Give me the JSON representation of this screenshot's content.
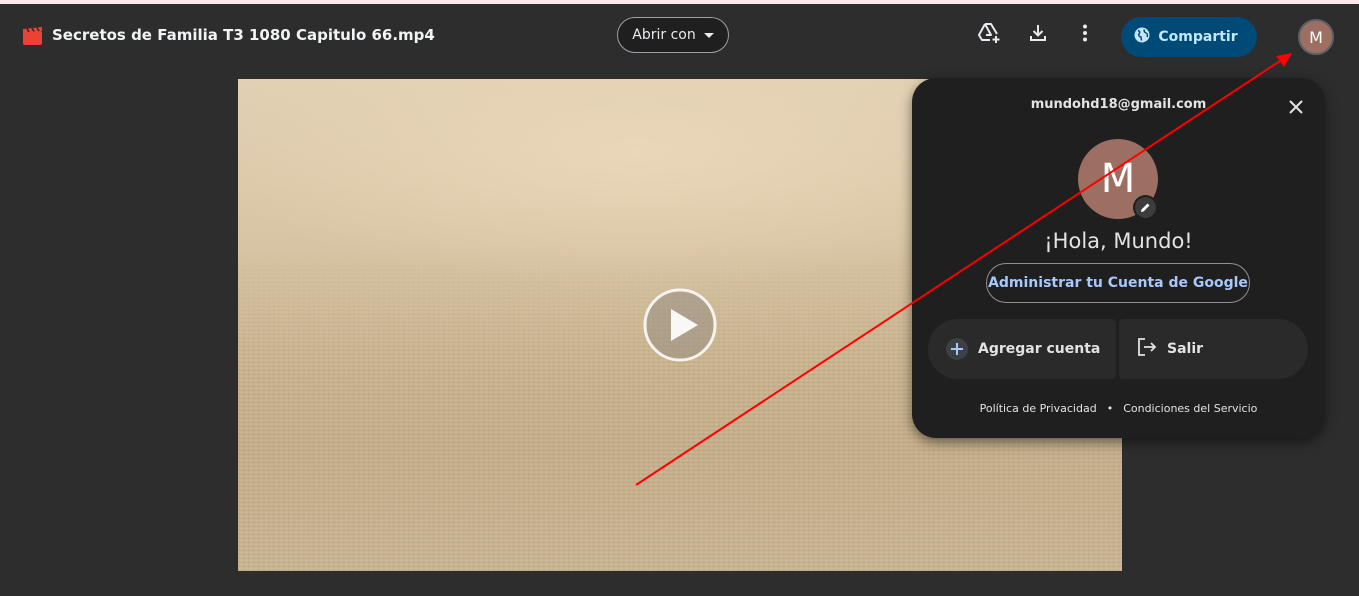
{
  "header": {
    "file_title": "Secretos de Familia T3 1080 Capitulo 66.mp4",
    "open_with_label": "Abrir con",
    "share_label": "Compartir",
    "avatar_initial": "M",
    "icons": [
      "video-file-icon",
      "add-to-drive-icon",
      "download-icon",
      "more-vert-icon",
      "globe-icon"
    ]
  },
  "video": {
    "play_icon": "play-icon"
  },
  "account_panel": {
    "email": "mundohd18@gmail.com",
    "avatar_initial": "M",
    "greeting": "¡Hola, Mundo!",
    "manage_label": "Administrar tu Cuenta de Google",
    "add_account_label": "Agregar cuenta",
    "sign_out_label": "Salir",
    "privacy_label": "Política de Privacidad",
    "separator": "•",
    "terms_label": "Condiciones del Servicio"
  },
  "colors": {
    "background": "#2d2d2d",
    "panel": "#1f1f1f",
    "share_button": "#004a77",
    "share_text": "#c2e7ff",
    "link_blue": "#a8c7fa",
    "avatar": "#9c6f62",
    "annotation_arrow": "#ff0000"
  }
}
